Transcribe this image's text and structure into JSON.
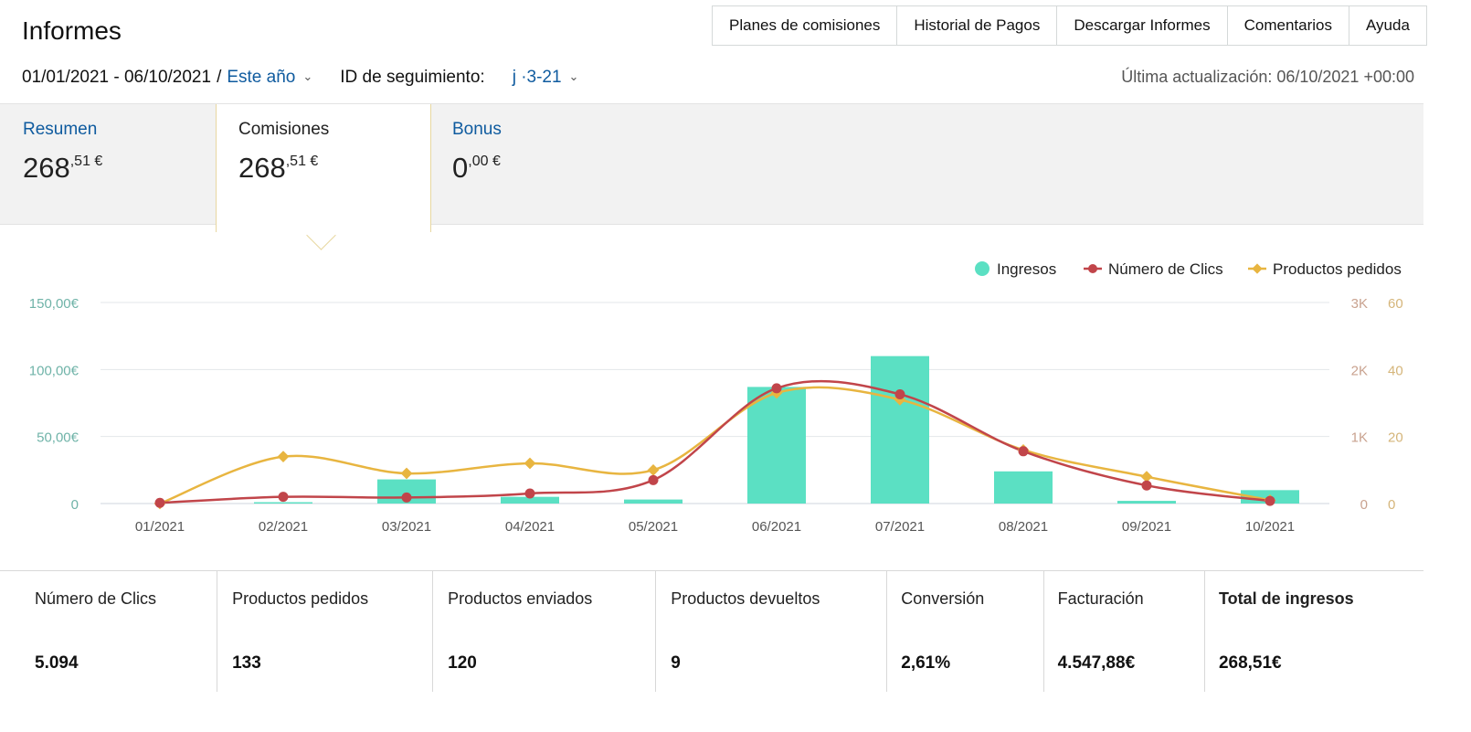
{
  "header": {
    "title": "Informes",
    "nav": [
      "Planes de comisiones",
      "Historial de Pagos",
      "Descargar Informes",
      "Comentarios",
      "Ayuda"
    ]
  },
  "filters": {
    "date_range": "01/01/2021 - 06/10/2021",
    "separator": "/",
    "period": "Este año",
    "tracking_label": "ID de seguimiento:",
    "tracking_value": "j        ·3-21",
    "last_update": "Última actualización: 06/10/2021 +00:00"
  },
  "summary": [
    {
      "label": "Resumen",
      "whole": "268",
      "frac": ",51 €"
    },
    {
      "label": "Comisiones",
      "whole": "268",
      "frac": ",51 €"
    },
    {
      "label": "Bonus",
      "whole": "0",
      "frac": ",00 €"
    }
  ],
  "chart_data": {
    "type": "bar",
    "categories": [
      "01/2021",
      "02/2021",
      "03/2021",
      "04/2021",
      "05/2021",
      "06/2021",
      "07/2021",
      "08/2021",
      "09/2021",
      "10/2021"
    ],
    "series": [
      {
        "name": "Ingresos",
        "type": "bar",
        "axis": "left",
        "color": "#5be0c3",
        "values": [
          0,
          1,
          18,
          5,
          3,
          87,
          110,
          24,
          2,
          10
        ]
      },
      {
        "name": "Número de Clics",
        "type": "line",
        "axis": "right-K",
        "color": "#c1454a",
        "values": [
          10,
          100,
          90,
          150,
          350,
          1720,
          1630,
          780,
          270,
          40
        ]
      },
      {
        "name": "Productos pedidos",
        "type": "line",
        "axis": "right",
        "color": "#e8b540",
        "values": [
          0,
          14,
          9,
          12,
          10,
          33,
          31,
          16,
          8,
          1
        ]
      }
    ],
    "left_axis": {
      "ticks": [
        "0",
        "50,00€",
        "100,00€",
        "150,00€"
      ],
      "ylim": [
        0,
        150
      ]
    },
    "right_axis_k": {
      "ticks": [
        "0",
        "1K",
        "2K",
        "3K"
      ],
      "ylim": [
        0,
        3000
      ]
    },
    "right_axis": {
      "ticks": [
        "0",
        "20",
        "40",
        "60"
      ],
      "ylim": [
        0,
        60
      ]
    },
    "legend_position": "top-right",
    "grid": true
  },
  "stats": [
    {
      "label": "Número de Clics",
      "value": "5.094"
    },
    {
      "label": "Productos pedidos",
      "value": "133"
    },
    {
      "label": "Productos enviados",
      "value": "120"
    },
    {
      "label": "Productos devueltos",
      "value": "9"
    },
    {
      "label": "Conversión",
      "value": "2,61%"
    },
    {
      "label": "Facturación",
      "value": "4.547,88€"
    },
    {
      "label": "Total de ingresos",
      "value": "268,51€"
    }
  ]
}
